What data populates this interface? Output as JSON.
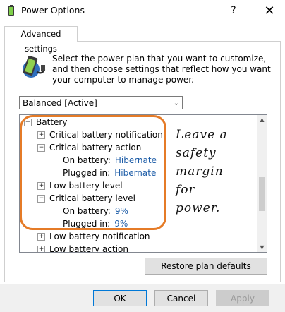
{
  "window": {
    "title": "Power Options",
    "help_symbol": "?",
    "close_symbol": "✕",
    "icon": "power-options-icon"
  },
  "tab": {
    "label": "Advanced settings"
  },
  "description": "Select the power plan that you want to customize, and then choose settings that reflect how you want your computer to manage power.",
  "plan_select": {
    "value": "Balanced [Active]"
  },
  "tree": {
    "rows": [
      {
        "toggle": "−",
        "label": "Battery"
      },
      {
        "toggle": "+",
        "label": "Critical battery notification"
      },
      {
        "toggle": "−",
        "label": "Critical battery action"
      },
      {
        "label": "On battery:",
        "value": "Hibernate"
      },
      {
        "label": "Plugged in:",
        "value": "Hibernate"
      },
      {
        "toggle": "+",
        "label": "Low battery level"
      },
      {
        "toggle": "−",
        "label": "Critical battery level"
      },
      {
        "label": "On battery:",
        "value": "9%"
      },
      {
        "label": "Plugged in:",
        "value": "9%"
      },
      {
        "toggle": "+",
        "label": "Low battery notification"
      },
      {
        "toggle": "+",
        "label": "Low battery action"
      }
    ]
  },
  "annotation": {
    "lines": [
      "Leave a",
      "safety",
      "margin",
      "for",
      "power."
    ],
    "highlight_color": "#e57b27"
  },
  "restore_button": "Restore plan defaults",
  "footer": {
    "ok": "OK",
    "cancel": "Cancel",
    "apply": "Apply"
  }
}
